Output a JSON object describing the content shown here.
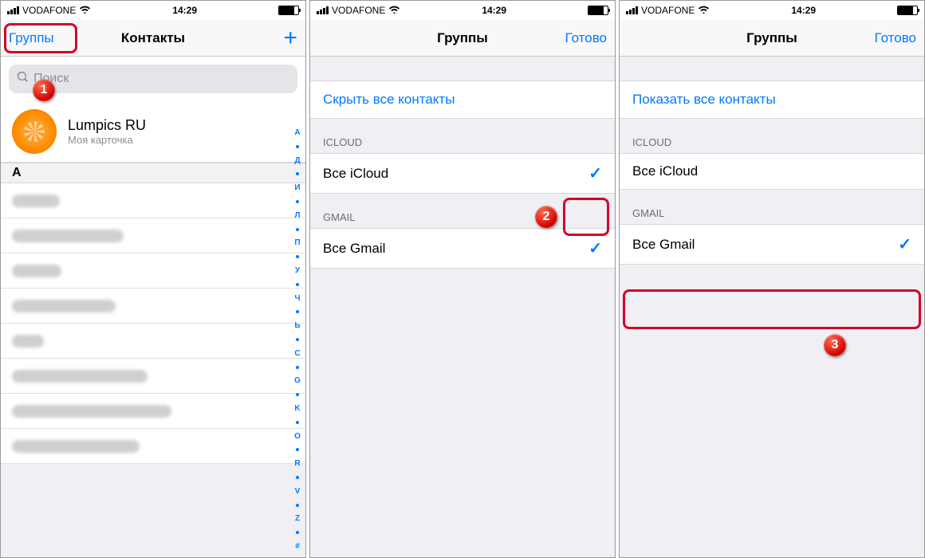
{
  "statusbar": {
    "carrier": "VODAFONE",
    "time": "14:29"
  },
  "phone1": {
    "nav": {
      "left": "Группы",
      "title": "Контакты"
    },
    "search_placeholder": "Поиск",
    "me": {
      "name": "Lumpics RU",
      "sub": "Моя карточка"
    },
    "section_letter": "А",
    "index_letters": [
      "А",
      "Д",
      "И",
      "Л",
      "П",
      "У",
      "Ч",
      "Ь",
      "C",
      "G",
      "K",
      "O",
      "R",
      "V",
      "Z",
      "#"
    ],
    "contact_widths": [
      60,
      140,
      62,
      130,
      40,
      170,
      200,
      160
    ]
  },
  "phone2": {
    "nav": {
      "title": "Группы",
      "right": "Готово"
    },
    "toggle_all": "Скрыть все контакты",
    "sections": {
      "icloud_hdr": "ICLOUD",
      "icloud_item": "Все iCloud",
      "gmail_hdr": "GMAIL",
      "gmail_item": "Все Gmail"
    }
  },
  "phone3": {
    "nav": {
      "title": "Группы",
      "right": "Готово"
    },
    "toggle_all": "Показать все контакты",
    "sections": {
      "icloud_hdr": "ICLOUD",
      "icloud_item": "Все iCloud",
      "gmail_hdr": "GMAIL",
      "gmail_item": "Все Gmail"
    }
  },
  "annotations": {
    "b1": "1",
    "b2": "2",
    "b3": "3"
  }
}
